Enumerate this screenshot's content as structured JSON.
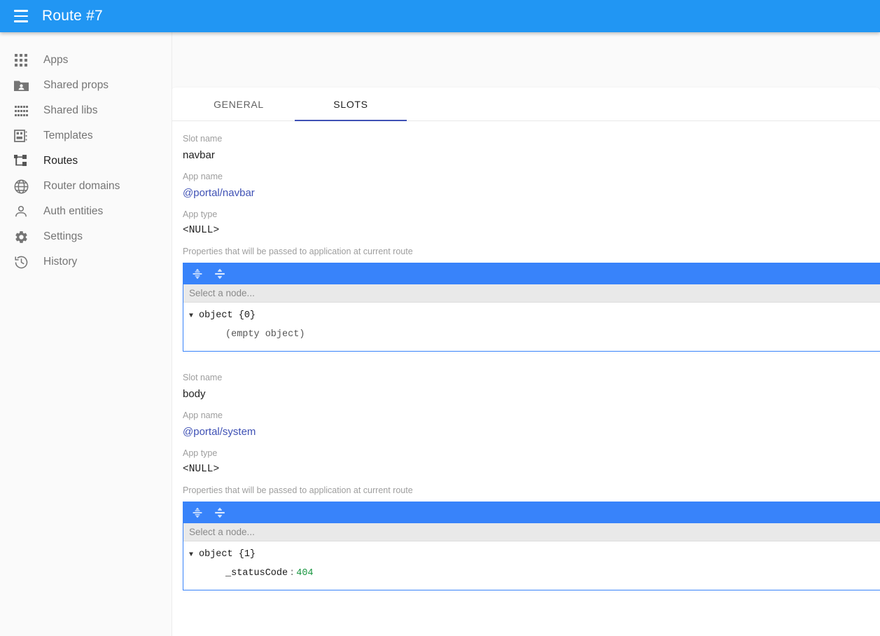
{
  "appbar": {
    "menu_icon": "hamburger-menu-icon",
    "title": "Route #7"
  },
  "sidebar": {
    "items": [
      {
        "label": "Apps",
        "icon": "apps-grid-icon",
        "active": false
      },
      {
        "label": "Shared props",
        "icon": "shared-folder-icon",
        "active": false
      },
      {
        "label": "Shared libs",
        "icon": "libs-grid-icon",
        "active": false
      },
      {
        "label": "Templates",
        "icon": "template-icon",
        "active": false
      },
      {
        "label": "Routes",
        "icon": "routes-tree-icon",
        "active": true
      },
      {
        "label": "Router domains",
        "icon": "globe-icon",
        "active": false
      },
      {
        "label": "Auth entities",
        "icon": "person-icon",
        "active": false
      },
      {
        "label": "Settings",
        "icon": "gear-icon",
        "active": false
      },
      {
        "label": "History",
        "icon": "history-clock-icon",
        "active": false
      }
    ]
  },
  "main": {
    "tabs": [
      {
        "label": "GENERAL",
        "active": false
      },
      {
        "label": "SLOTS",
        "active": true
      }
    ],
    "labels": {
      "slot_name": "Slot name",
      "app_name": "App name",
      "app_type": "App type",
      "props": "Properties that will be passed to application at current route"
    },
    "slots": [
      {
        "slot_name": "navbar",
        "app_name": "@portal/navbar",
        "app_type": "<NULL>",
        "editor": {
          "expand_icon": "expand-all-icon",
          "collapse_icon": "collapse-all-icon",
          "search_placeholder": "Select a node...",
          "root_caret": "▼",
          "root_type": "object",
          "root_count": "{0}",
          "empty_text": "(empty object)",
          "entries": []
        }
      },
      {
        "slot_name": "body",
        "app_name": "@portal/system",
        "app_type": "<NULL>",
        "editor": {
          "expand_icon": "expand-all-icon",
          "collapse_icon": "collapse-all-icon",
          "search_placeholder": "Select a node...",
          "root_caret": "▼",
          "root_type": "object",
          "root_count": "{1}",
          "empty_text": "",
          "entries": [
            {
              "key": "_statusCode",
              "colon": ":",
              "value": "404",
              "value_kind": "number"
            }
          ]
        }
      }
    ]
  },
  "colors": {
    "appbar": "#2196f3",
    "accent_tab": "#3f51b5",
    "editor_toolbar": "#3883fa",
    "link": "#3f51b5",
    "number_value": "#1a9641",
    "page_bg": "#fafafa"
  }
}
